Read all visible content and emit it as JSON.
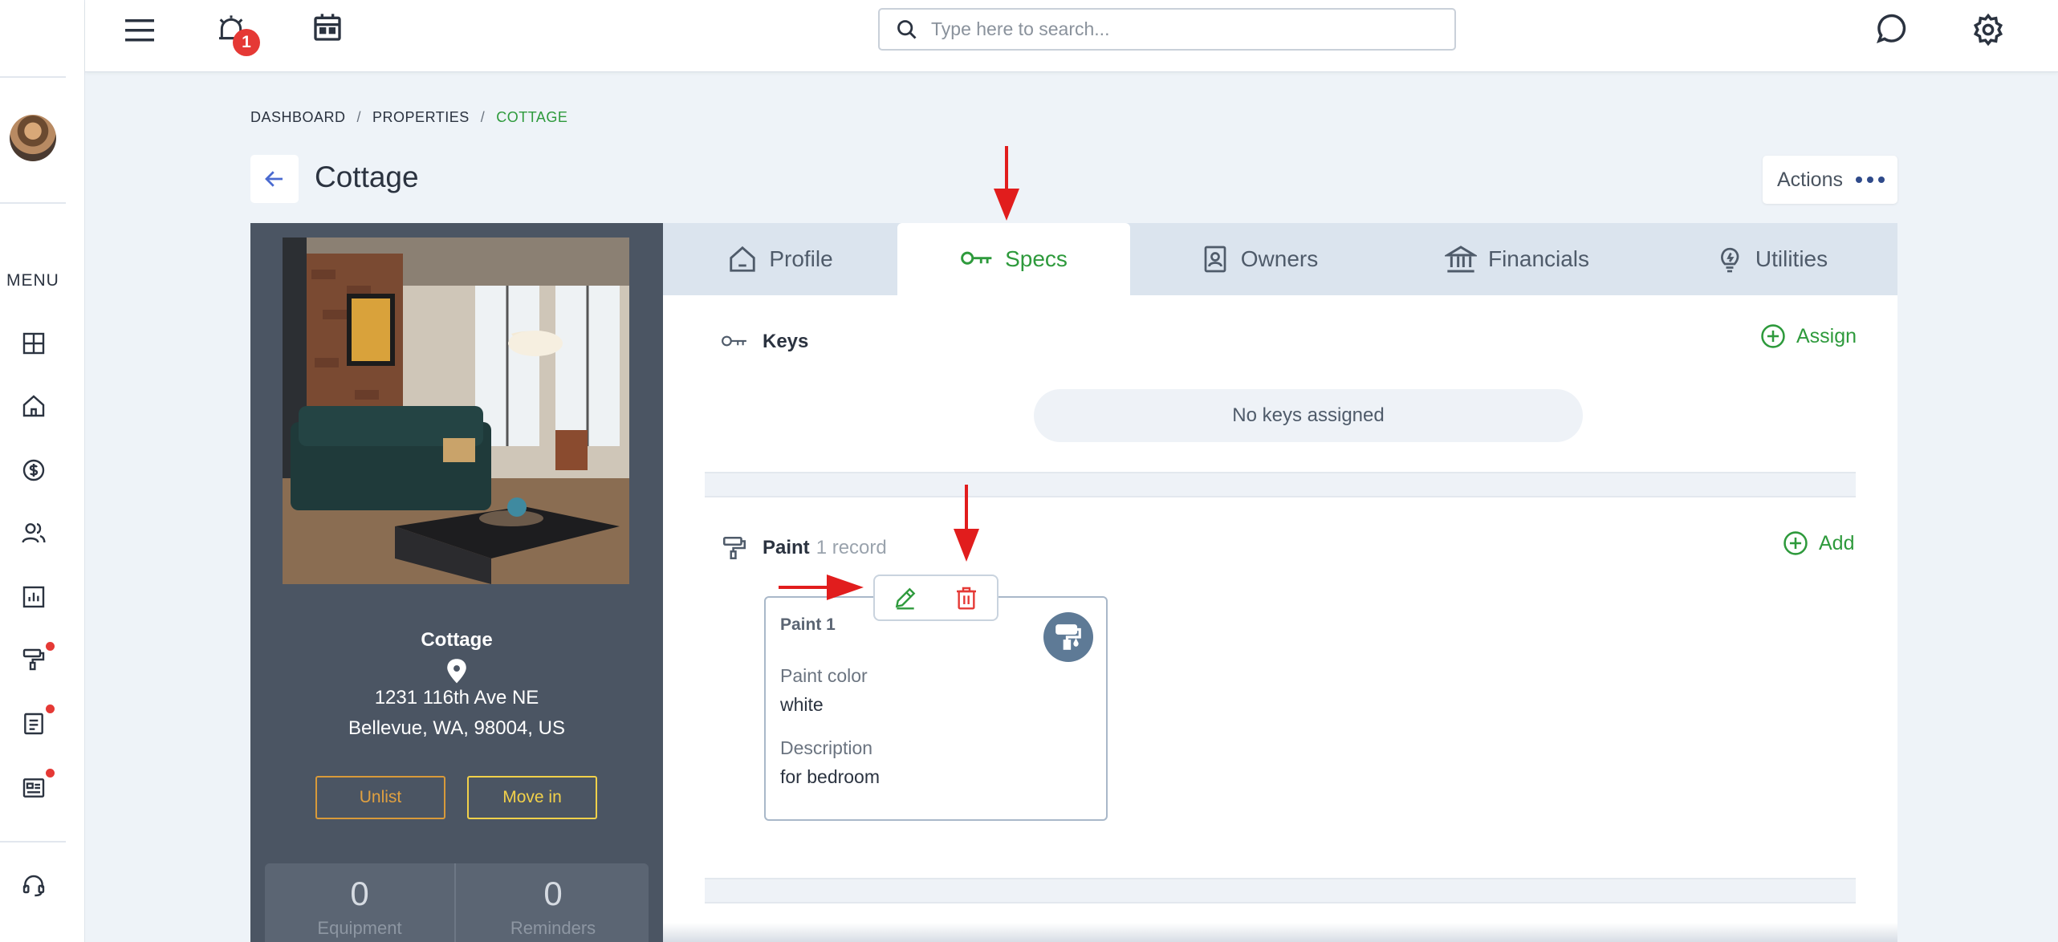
{
  "topbar": {
    "notification_count": "1",
    "search_placeholder": "Type here to search..."
  },
  "sidebar": {
    "menu_label": "MENU",
    "items": [
      {
        "icon": "dashboard-grid-icon",
        "dot": false
      },
      {
        "icon": "home-icon",
        "dot": false
      },
      {
        "icon": "dollar-circle-icon",
        "dot": false
      },
      {
        "icon": "users-icon",
        "dot": false
      },
      {
        "icon": "bar-chart-icon",
        "dot": false
      },
      {
        "icon": "paint-roller-icon",
        "dot": true
      },
      {
        "icon": "document-icon",
        "dot": true
      },
      {
        "icon": "news-icon",
        "dot": true
      },
      {
        "icon": "support-headset-icon",
        "dot": false
      }
    ]
  },
  "breadcrumb": {
    "items": [
      "DASHBOARD",
      "PROPERTIES",
      "COTTAGE"
    ],
    "separator": "/"
  },
  "page": {
    "title": "Cottage",
    "actions_label": "Actions"
  },
  "property": {
    "name": "Cottage",
    "address_line1": "1231 116th Ave NE",
    "address_line2": "Bellevue, WA, 98004, US",
    "unlist_label": "Unlist",
    "movein_label": "Move in",
    "stats": [
      {
        "value": "0",
        "label": "Equipment"
      },
      {
        "value": "0",
        "label": "Reminders"
      }
    ]
  },
  "tabs": [
    {
      "label": "Profile",
      "icon": "house-icon"
    },
    {
      "label": "Specs",
      "icon": "key-icon",
      "active": true
    },
    {
      "label": "Owners",
      "icon": "owner-badge-icon"
    },
    {
      "label": "Financials",
      "icon": "bank-icon"
    },
    {
      "label": "Utilities",
      "icon": "lightbulb-icon"
    }
  ],
  "keys": {
    "title": "Keys",
    "assign_label": "Assign",
    "empty_text": "No keys assigned"
  },
  "paint": {
    "title": "Paint",
    "count_text": "1 record",
    "add_label": "Add",
    "record": {
      "title": "Paint 1",
      "color_label": "Paint color",
      "color_value": "white",
      "desc_label": "Description",
      "desc_value": "for bedroom"
    }
  },
  "colors": {
    "accent_green": "#2e9a3c",
    "danger_red": "#e53935",
    "card_dark": "#4b5563",
    "unlist_orange": "#e0a040",
    "movein_yellow": "#f2d14a"
  }
}
